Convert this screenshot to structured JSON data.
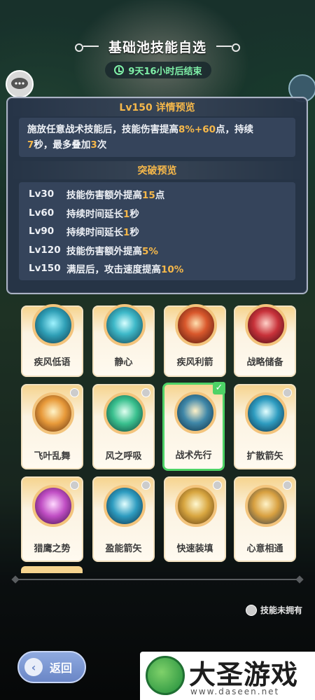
{
  "header": {
    "title": "基础池技能自选",
    "timer": "9天16小时后结束"
  },
  "detail": {
    "title": "Lv150 详情预览",
    "desc_parts": [
      "施放任意战术技能后，技能伤害提高",
      "8%",
      "+",
      "60",
      "点，持续",
      "7",
      "秒，最多叠加",
      "3",
      "次"
    ],
    "breakthrough_title": "突破预览",
    "breakthroughs": [
      {
        "level": "Lv30",
        "pre": "技能伤害额外提高",
        "val": "15",
        "post": "点"
      },
      {
        "level": "Lv60",
        "pre": "持续时间延长",
        "val": "1",
        "post": "秒"
      },
      {
        "level": "Lv90",
        "pre": "持续时间延长",
        "val": "1",
        "post": "秒"
      },
      {
        "level": "Lv120",
        "pre": "技能伤害额外提高",
        "val": "5",
        "post": "%"
      },
      {
        "level": "Lv150",
        "pre": "满层后，攻击速度提高",
        "val": "10",
        "post": "%"
      }
    ]
  },
  "skills": [
    {
      "name": "疾风低语",
      "icon": "wind-whisper-icon",
      "selected": false,
      "locked": false
    },
    {
      "name": "静心",
      "icon": "calm-heart-icon",
      "selected": false,
      "locked": false
    },
    {
      "name": "疾风利箭",
      "icon": "gale-arrow-icon",
      "selected": false,
      "locked": false
    },
    {
      "name": "战略储备",
      "icon": "strategy-reserve-icon",
      "selected": false,
      "locked": false
    },
    {
      "name": "飞叶乱舞",
      "icon": "flying-leaves-icon",
      "selected": false,
      "locked": true
    },
    {
      "name": "风之呼吸",
      "icon": "wind-breath-icon",
      "selected": false,
      "locked": true
    },
    {
      "name": "战术先行",
      "icon": "tactics-first-icon",
      "selected": true,
      "locked": false
    },
    {
      "name": "扩散箭矢",
      "icon": "spread-arrows-icon",
      "selected": false,
      "locked": true
    },
    {
      "name": "猎鹰之势",
      "icon": "falcon-stance-icon",
      "selected": false,
      "locked": true
    },
    {
      "name": "盈能箭矢",
      "icon": "charged-arrow-icon",
      "selected": false,
      "locked": true
    },
    {
      "name": "快速装填",
      "icon": "quick-reload-icon",
      "selected": false,
      "locked": true
    },
    {
      "name": "心意相通",
      "icon": "heart-link-icon",
      "selected": false,
      "locked": true
    }
  ],
  "legend": "技能未拥有",
  "back": "返回",
  "watermark": {
    "name": "大圣游戏网",
    "url": "www.daseen.net"
  },
  "colors": {
    "highlight": "#f6b84a",
    "selected_border": "#4dd266",
    "timer": "#7ff0a8"
  }
}
